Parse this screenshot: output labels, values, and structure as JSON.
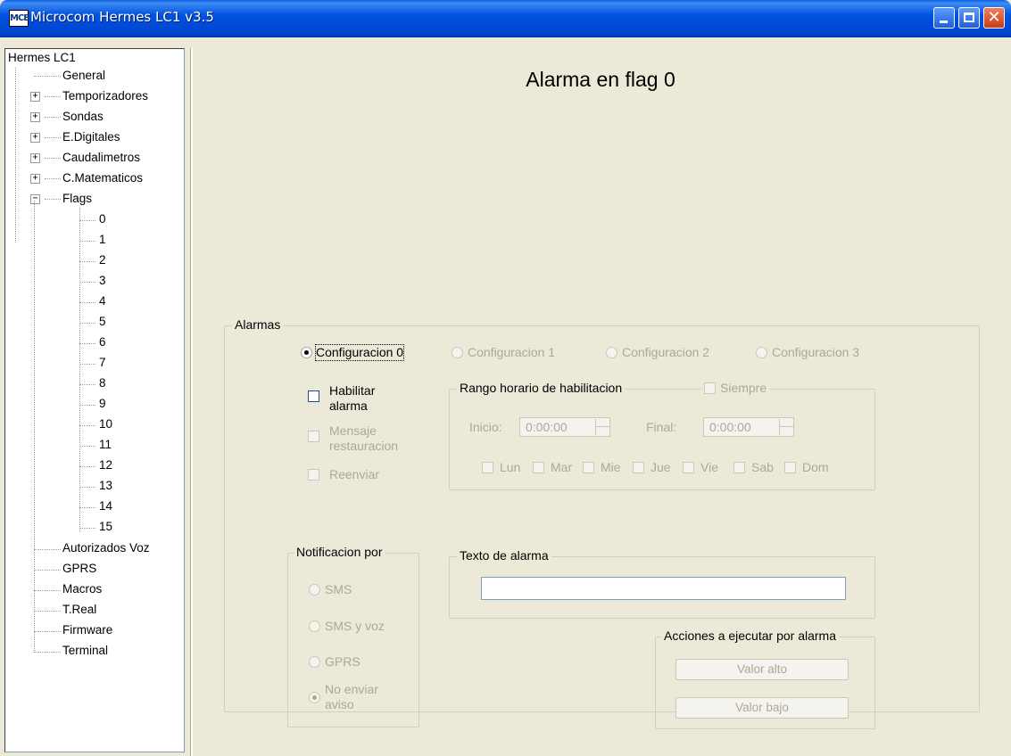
{
  "window": {
    "title": "Microcom Hermes LC1 v3.5",
    "icon_text": "MCE"
  },
  "tree": {
    "root": "Hermes LC1",
    "items": [
      {
        "label": "General"
      },
      {
        "label": "Temporizadores",
        "expander": "+"
      },
      {
        "label": "Sondas",
        "expander": "+"
      },
      {
        "label": "E.Digitales",
        "expander": "+"
      },
      {
        "label": "Caudalimetros",
        "expander": "+"
      },
      {
        "label": "C.Matematicos",
        "expander": "+"
      },
      {
        "label": "Flags",
        "expander": "−"
      }
    ],
    "flags": [
      "0",
      "1",
      "2",
      "3",
      "4",
      "5",
      "6",
      "7",
      "8",
      "9",
      "10",
      "11",
      "12",
      "13",
      "14",
      "15"
    ],
    "bottom_items": [
      "Autorizados Voz",
      "GPRS",
      "Macros",
      "T.Real",
      "Firmware",
      "Terminal"
    ]
  },
  "page": {
    "title": "Alarma en flag  0"
  },
  "alarmas": {
    "label": "Alarmas",
    "configs": [
      "Configuracion 0",
      "Configuracion 1",
      "Configuracion 2",
      "Configuracion 3"
    ],
    "selected_config": 0,
    "habilitar_label": [
      "Habilitar",
      "alarma"
    ],
    "mensaje_label": [
      "Mensaje",
      "restauracion"
    ],
    "reenviar_label": "Reenviar",
    "rango": {
      "label": "Rango horario de habilitacion",
      "siempre_label": "Siempre",
      "inicio_label": "Inicio:",
      "inicio_value": "0:00:00",
      "final_label": "Final:",
      "final_value": "0:00:00",
      "days": [
        "Lun",
        "Mar",
        "Mie",
        "Jue",
        "Vie",
        "Sab",
        "Dom"
      ]
    },
    "notificacion": {
      "label": "Notificacion por",
      "options": [
        "SMS",
        "SMS y voz",
        "GPRS"
      ],
      "no_enviar": [
        "No enviar",
        "aviso"
      ],
      "selected": "No enviar aviso"
    },
    "texto": {
      "label": "Texto de alarma",
      "value": ""
    },
    "acciones": {
      "label": "Acciones a ejecutar por alarma",
      "valor_alto": "Valor alto",
      "valor_bajo": "Valor bajo"
    }
  }
}
